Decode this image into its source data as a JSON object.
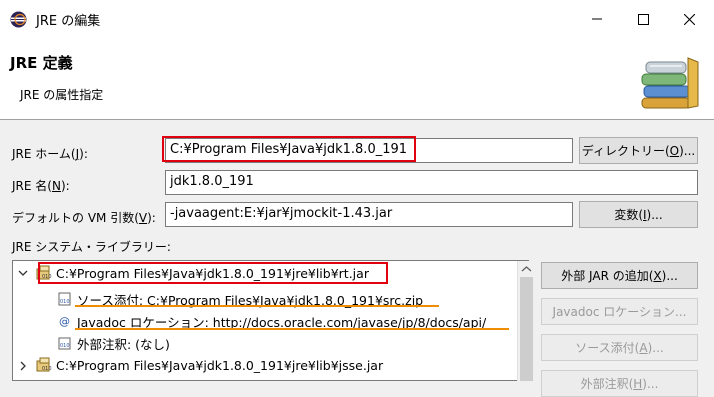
{
  "window": {
    "title": "JRE の編集"
  },
  "header": {
    "title": "JRE 定義",
    "subtitle": "JRE の属性指定"
  },
  "fields": {
    "home": {
      "label": "JRE ホーム(",
      "accel": "J",
      "label_end": "):",
      "value": "C:¥Program Files¥Java¥jdk1.8.0_191"
    },
    "name": {
      "label": "JRE 名(",
      "accel": "N",
      "label_end": "):",
      "value": "jdk1.8.0_191"
    },
    "vm_args": {
      "label": "デフォルトの VM 引数(",
      "accel": "V",
      "label_end": "):",
      "value": "-javaagent:E:¥jar¥jmockit-1.43.jar"
    }
  },
  "buttons": {
    "directory": {
      "text": "ディレクトリー(",
      "accel": "O",
      "end": ")..."
    },
    "variables": {
      "text": "変数(",
      "accel": "I",
      "end": ")..."
    },
    "add_external_jar": {
      "text": "外部 JAR の追加(",
      "accel": "X",
      "end": ")..."
    },
    "javadoc_location": {
      "text": "Javadoc ロケーション..."
    },
    "source_attach": {
      "text": "ソース添付(",
      "accel": "A",
      "end": ")..."
    },
    "external_annotation": {
      "text": "外部注釈(",
      "accel": "H",
      "end": ")..."
    }
  },
  "libraries": {
    "label": "JRE システム・ライブラリー:",
    "items": [
      {
        "text": "C:¥Program Files¥Java¥jdk1.8.0_191¥jre¥lib¥rt.jar",
        "expanded": true,
        "children": [
          {
            "text": "ソース添付: C:¥Program Files¥Java¥jdk1.8.0_191¥src.zip"
          },
          {
            "text": "Javadoc ロケーション: http://docs.oracle.com/javase/jp/8/docs/api/"
          },
          {
            "text": "外部注釈: (なし)"
          }
        ]
      },
      {
        "text": "C:¥Program Files¥Java¥jdk1.8.0_191¥jre¥lib¥jsse.jar",
        "expanded": false
      }
    ]
  },
  "colors": {
    "highlight_box": "#e0000f",
    "underline": "#f08c00"
  }
}
